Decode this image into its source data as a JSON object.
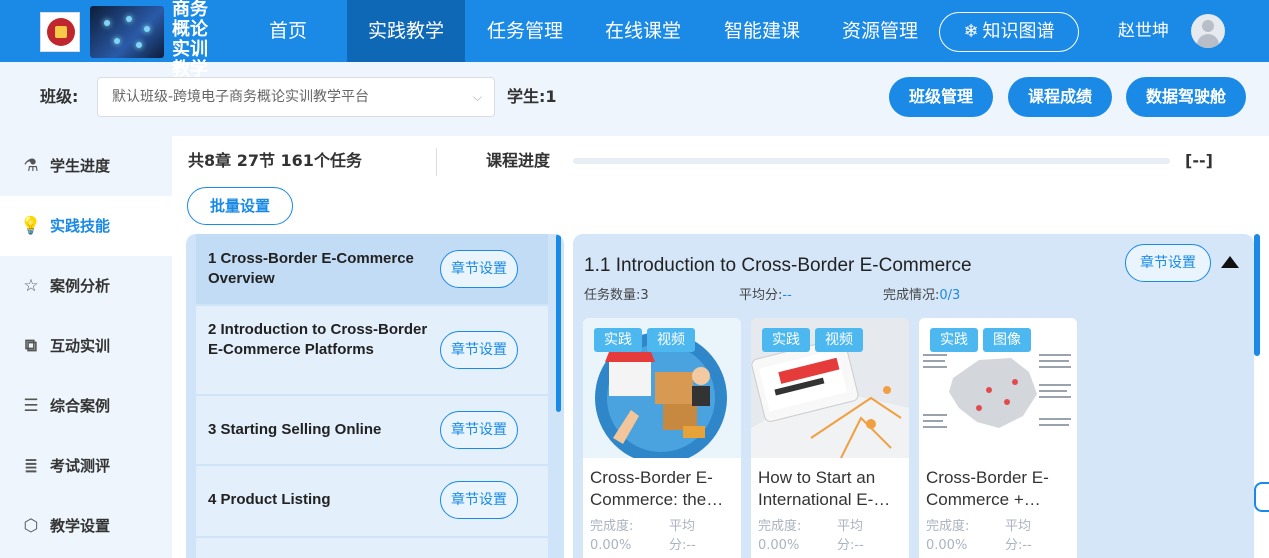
{
  "header": {
    "brand_lines": [
      "商务",
      "概论",
      "实训",
      "教学"
    ],
    "nav": [
      "首页",
      "实践教学",
      "任务管理",
      "在线课堂",
      "智能建课",
      "资源管理"
    ],
    "active_nav": "实践教学",
    "knowledge_graph_label": "知识图谱",
    "username": "赵世坤"
  },
  "class_bar": {
    "label": "班级:",
    "selected_class": "默认班级-跨境电子商务概论实训教学平台",
    "students": "学生:1",
    "buttons": [
      "班级管理",
      "课程成绩",
      "数据驾驶舱"
    ]
  },
  "sidebar": {
    "items": [
      "学生进度",
      "实践技能",
      "案例分析",
      "互动实训",
      "综合案例",
      "考试测评",
      "教学设置"
    ],
    "active": "实践技能"
  },
  "summary": {
    "text": "共8章 27节  161个任务",
    "progress_label": "课程进度",
    "progress_fraction": 0,
    "progress_value": "[--]",
    "batch_label": "批量设置"
  },
  "chapters": [
    {
      "title": "1 Cross-Border E-Commerce Overview",
      "button": "章节设置"
    },
    {
      "title": "2 Introduction to Cross-Border E-Commerce Platforms",
      "button": "章节设置"
    },
    {
      "title": "3 Starting Selling Online",
      "button": "章节设置"
    },
    {
      "title": "4 Product Listing",
      "button": "章节设置"
    }
  ],
  "section": {
    "title": "1.1 Introduction to Cross-Border E-Commerce",
    "settings_label": "章节设置",
    "task_count_label": "任务数量:",
    "task_count": "3",
    "avg_label": "平均分:",
    "avg_value": "--",
    "completion_label": "完成情况:",
    "completion_value": "0/3",
    "cards": [
      {
        "tags": [
          "实践",
          "视频"
        ],
        "title_lines": [
          "Cross-Border E-",
          "Commerce: the…"
        ],
        "done_label": "完成度:",
        "done_value": "0.00%",
        "avg_label": "平均",
        "avg_label2": "分:",
        "avg_value": "--"
      },
      {
        "tags": [
          "实践",
          "视频"
        ],
        "title_lines": [
          "How to Start an",
          "International E-…"
        ],
        "done_label": "完成度:",
        "done_value": "0.00%",
        "avg_label": "平均",
        "avg_label2": "分:",
        "avg_value": "--"
      },
      {
        "tags": [
          "实践",
          "图像"
        ],
        "title_lines": [
          "Cross-Border E-",
          "Commerce +…"
        ],
        "done_label": "完成度:",
        "done_value": "0.00%",
        "avg_label": "平均",
        "avg_label2": "分:",
        "avg_value": "--"
      }
    ]
  },
  "colors": {
    "primary": "#1a8ae6",
    "nav_active": "#0f68b6",
    "tag": "#4db8ef"
  }
}
